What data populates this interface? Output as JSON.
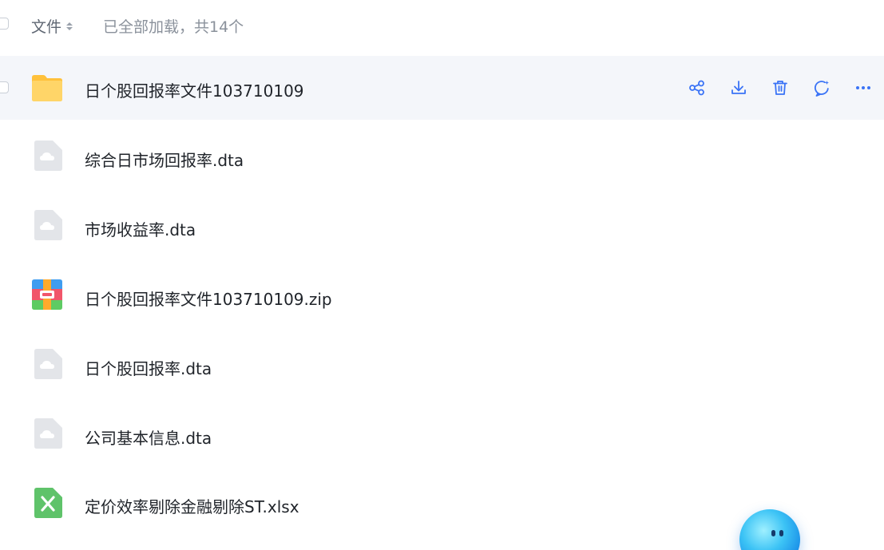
{
  "header": {
    "column_label": "文件",
    "count_text": "已全部加载，共14个"
  },
  "files": [
    {
      "name": "日个股回报率文件103710109",
      "type": "folder",
      "icon": "folder-icon",
      "hovered": true
    },
    {
      "name": "综合日市场回报率.dta",
      "type": "dta",
      "icon": "cloud-file-icon"
    },
    {
      "name": "市场收益率.dta",
      "type": "dta",
      "icon": "cloud-file-icon"
    },
    {
      "name": "日个股回报率文件103710109.zip",
      "type": "zip",
      "icon": "zip-icon"
    },
    {
      "name": "日个股回报率.dta",
      "type": "dta",
      "icon": "cloud-file-icon"
    },
    {
      "name": "公司基本信息.dta",
      "type": "dta",
      "icon": "cloud-file-icon"
    },
    {
      "name": "定价效率剔除金融剔除ST.xlsx",
      "type": "xlsx",
      "icon": "excel-icon"
    }
  ],
  "row_actions": [
    {
      "name": "share",
      "icon": "share-icon"
    },
    {
      "name": "download",
      "icon": "download-icon"
    },
    {
      "name": "delete",
      "icon": "trash-icon"
    },
    {
      "name": "ai-chat",
      "icon": "ai-chat-icon"
    },
    {
      "name": "more",
      "icon": "more-icon"
    }
  ],
  "colors": {
    "accent": "#3a73f6",
    "hover_row": "#f4f6fa",
    "folder": "#ffc94a",
    "excel": "#5fc36a"
  }
}
